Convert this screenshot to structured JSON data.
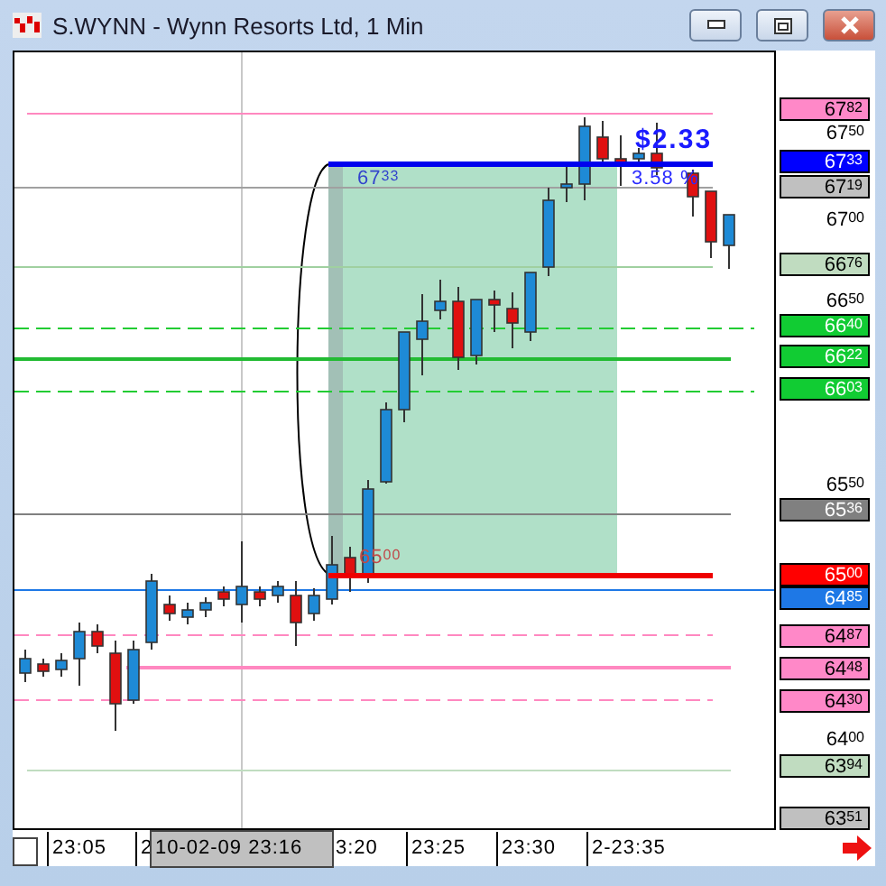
{
  "window": {
    "title": "S.WYNN - Wynn Resorts Ltd, 1 Min"
  },
  "annotations": [
    {
      "kind": "level",
      "text": "67$^{33}$",
      "color": "#3344cc"
    },
    {
      "kind": "level",
      "text": "65$^{00}$",
      "color": "#c04a4a"
    },
    {
      "kind": "gain",
      "text": "$2.33",
      "color": "#1a1aff"
    },
    {
      "kind": "percent",
      "text": "3.58 %",
      "color": "#2a2aff"
    }
  ],
  "price_labels": [
    {
      "text": "67$^{82}$",
      "color": "#ff88c8"
    },
    {
      "text": "67$^{50}$"
    },
    {
      "text": "67$^{33}$",
      "color": "#0000ff"
    },
    {
      "text": "67$^{19}$",
      "color": "#c0c0c0"
    },
    {
      "text": "67$^{00}$"
    },
    {
      "text": "66$^{76}$",
      "color": "#c0dcc0"
    },
    {
      "text": "66$^{50}$"
    },
    {
      "text": "66$^{40}$",
      "color": "#11cc33"
    },
    {
      "text": "66$^{22}$",
      "color": "#11cc33"
    },
    {
      "text": "66$^{03}$",
      "color": "#11cc33"
    },
    {
      "text": "65$^{50}$"
    },
    {
      "text": "65$^{36}$",
      "color": "#808080"
    },
    {
      "text": "65$^{00}$",
      "color": "#ff0000"
    },
    {
      "text": "64$^{85}$",
      "color": "#1e78e6"
    },
    {
      "text": "64$^{87}$",
      "color": "#ff88c8"
    },
    {
      "text": "64$^{48}$",
      "color": "#ff88c8"
    },
    {
      "text": "64$^{30}$",
      "color": "#ff88c8"
    },
    {
      "text": "64$^{00}$"
    },
    {
      "text": "63$^{94}$",
      "color": "#c0dcc0"
    },
    {
      "text": "63$^{51}$",
      "color": "#c0c0c0"
    }
  ],
  "time_axis": [
    {
      "label": "23:05",
      "selected": false
    },
    {
      "label": "2",
      "selected": false
    },
    {
      "label": "10-02-09 23:16",
      "selected": true
    },
    {
      "label": "3:20",
      "selected": false
    },
    {
      "label": "23:25",
      "selected": false
    },
    {
      "label": "23:30",
      "selected": false
    },
    {
      "label": "2-23:35",
      "selected": false
    }
  ]
}
